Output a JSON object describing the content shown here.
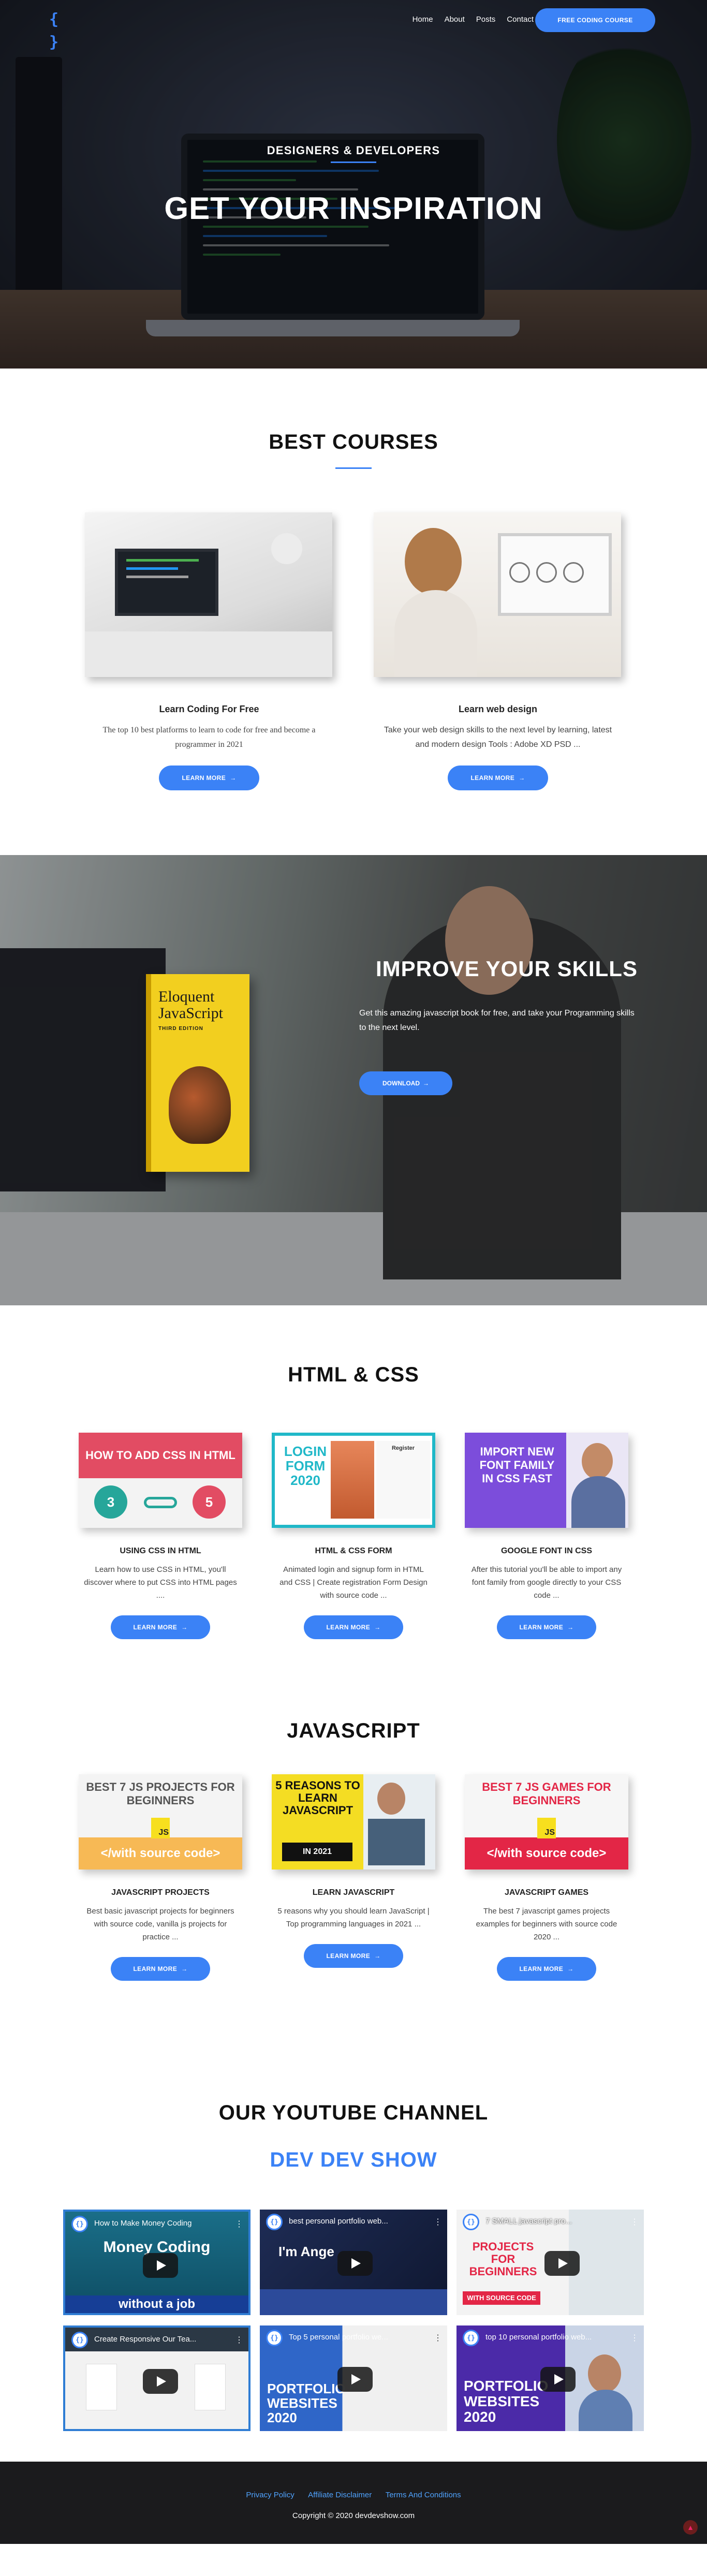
{
  "nav": {
    "logo": "{ }",
    "links": [
      "Home",
      "About",
      "Posts",
      "Contact"
    ],
    "cta": "FREE CODING COURSE"
  },
  "hero": {
    "subtitle": "DESIGNERS & DEVELOPERS",
    "title": "GET YOUR INSPIRATION"
  },
  "courses": {
    "title": "BEST COURSES",
    "items": [
      {
        "title": "Learn Coding For Free",
        "desc": "The top 10 best platforms to learn to code for free and become a programmer in 2021",
        "button": "LEARN MORE"
      },
      {
        "title": "Learn web design",
        "desc": "Take your web design skills to the next level by learning, latest and modern design Tools : Adobe XD PSD ...",
        "button": "LEARN MORE"
      }
    ]
  },
  "skills": {
    "title": "IMPROVE YOUR SKILLS",
    "desc": "Get this amazing javascript book for free, and take your Programming skills to the next level.",
    "button": "DOWNLOAD",
    "book_title_1": "Eloquent",
    "book_title_2": "JavaScript",
    "book_edition": "THIRD EDITION"
  },
  "htmlcss": {
    "title": "HTML & CSS",
    "items": [
      {
        "title": "USING CSS IN HTML",
        "desc": "Learn how to use CSS in HTML, you'll discover where to put CSS into HTML pages ....",
        "button": "LEARN MORE",
        "thumb": "HOW TO ADD CSS IN HTML"
      },
      {
        "title": "HTML & CSS FORM",
        "desc": "Animated login and signup form in HTML and CSS | Create registration Form Design with source code ...",
        "button": "LEARN MORE",
        "thumb": "LOGIN FORM 2020",
        "thumb_sub": "Register"
      },
      {
        "title": "GOOGLE FONT IN CSS",
        "desc": "After this tutorial you'll be able to import any font family from google directly to your CSS code ...",
        "button": "LEARN MORE",
        "thumb": "IMPORT NEW FONT FAMILY IN CSS FAST"
      }
    ]
  },
  "javascript": {
    "title": "JAVASCRIPT",
    "items": [
      {
        "title": "JAVASCRIPT PROJECTS",
        "desc": "Best basic javascript projects for beginners with source code, vanilla js projects for practice ...",
        "button": "LEARN MORE",
        "thumb": "BEST 7 JS PROJECTS FOR BEGINNERS",
        "thumb_sub": "</with source code>"
      },
      {
        "title": "LEARN JAVASCRIPT",
        "desc": "5 reasons why you should learn JavaScript | Top programming languages in 2021 ...",
        "button": "LEARN MORE",
        "thumb": "5 REASONS TO LEARN JAVASCRIPT",
        "thumb_sub": "IN 2021"
      },
      {
        "title": "JAVASCRIPT GAMES",
        "desc": "The best 7 javascript games projects examples for beginners with source code 2020 ...",
        "button": "LEARN MORE",
        "thumb": "BEST 7 JS GAMES FOR BEGINNERS",
        "thumb_sub": "</with source code>"
      }
    ]
  },
  "youtube": {
    "title": "OUR YOUTUBE CHANNEL",
    "channel": "DEV DEV SHOW",
    "videos": [
      {
        "title": "How to Make Money Coding",
        "big": "Money Coding",
        "sub": "without a job"
      },
      {
        "title": "best personal portfolio web...",
        "big": "I'm Ange"
      },
      {
        "title": "7 SMALL javascript pro...",
        "big": "PROJECTS FOR BEGINNERS",
        "sub": "WITH SOURCE CODE"
      },
      {
        "title": "Create Responsive Our Tea...",
        "big": ""
      },
      {
        "title": "Top 5 personal portfolio we...",
        "big": "PORTFOLIO WEBSITES 2020"
      },
      {
        "title": "top 10 personal portfolio web...",
        "big": "PORTFOLIO WEBSITES 2020"
      }
    ]
  },
  "footer": {
    "links": [
      "Privacy Policy",
      "Affiliate Disclaimer",
      "Terms And Conditions"
    ],
    "copyright": "Copyright © 2020 devdevshow.com"
  },
  "colors": {
    "accent": "#3b82f6",
    "footer_bg": "#1b1b1d"
  },
  "icons": {
    "arrow": "arrow-right-icon",
    "to_top": "arrow-up-icon"
  }
}
